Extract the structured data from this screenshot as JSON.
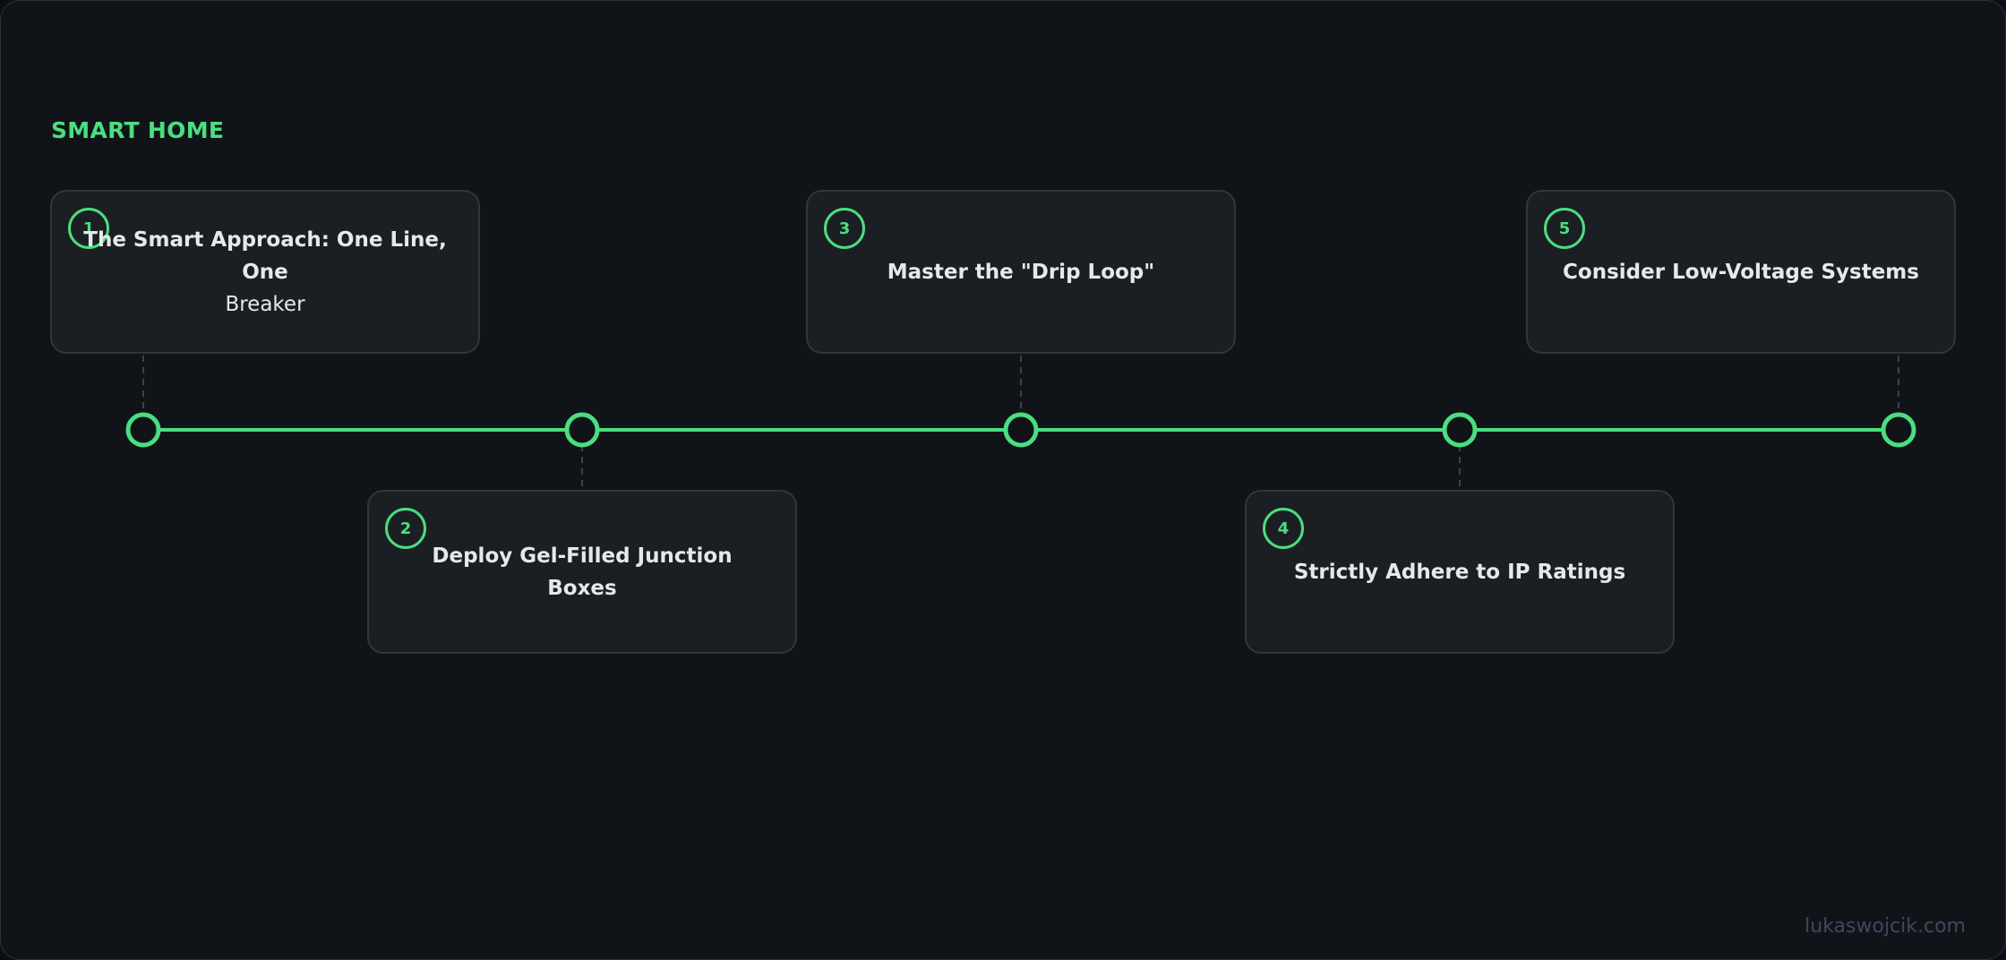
{
  "header": {
    "title": "SMART HOME"
  },
  "steps": [
    {
      "number": "1",
      "title_line1": "The Smart Approach: One Line, One",
      "title_line2": "Breaker"
    },
    {
      "number": "2",
      "title_line1": "Deploy Gel-Filled Junction Boxes",
      "title_line2": ""
    },
    {
      "number": "3",
      "title_line1": "Master the \"Drip Loop\"",
      "title_line2": ""
    },
    {
      "number": "4",
      "title_line1": "Strictly Adhere to IP Ratings",
      "title_line2": ""
    },
    {
      "number": "5",
      "title_line1": "Consider Low-Voltage Systems",
      "title_line2": ""
    }
  ],
  "footer": {
    "credit": "lukaswojcik.com"
  },
  "colors": {
    "accent": "#4ade80",
    "background": "#101418",
    "card": "#1b1f23",
    "card_border": "#2e363f",
    "connector": "#3a434d"
  }
}
